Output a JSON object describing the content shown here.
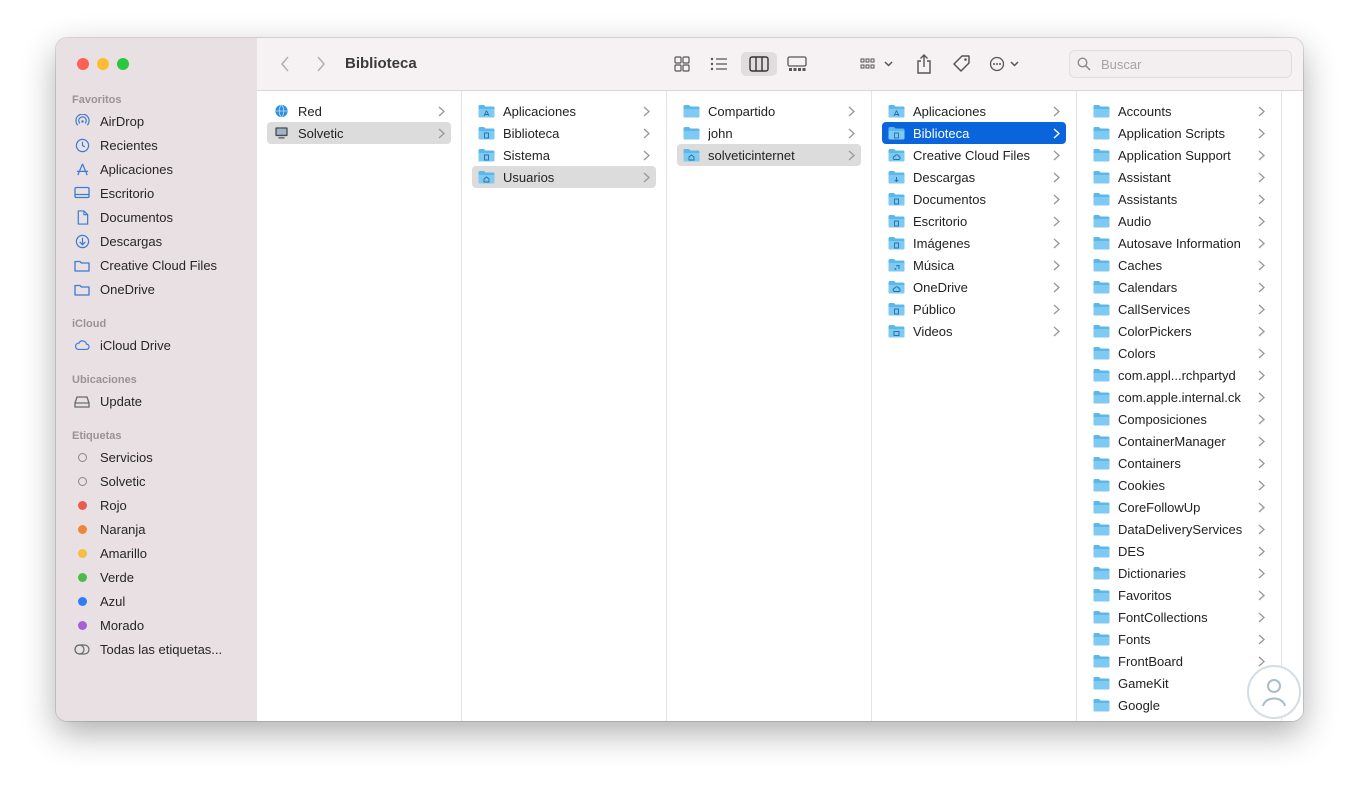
{
  "colors": {
    "accent": "#0a64dc",
    "close": "#fe5f57",
    "minimize": "#febc2e",
    "zoom": "#28c840",
    "folder": "#5bb8e8"
  },
  "toolbar": {
    "title": "Biblioteca",
    "search_placeholder": "Buscar"
  },
  "sidebar": {
    "favorites_title": "Favoritos",
    "favorites": [
      {
        "label": "AirDrop",
        "icon": "airdrop-icon"
      },
      {
        "label": "Recientes",
        "icon": "clock-icon"
      },
      {
        "label": "Aplicaciones",
        "icon": "apps-icon"
      },
      {
        "label": "Escritorio",
        "icon": "desktop-icon"
      },
      {
        "label": "Documentos",
        "icon": "document-icon"
      },
      {
        "label": "Descargas",
        "icon": "download-icon"
      },
      {
        "label": "Creative Cloud Files",
        "icon": "folder-icon"
      },
      {
        "label": "OneDrive",
        "icon": "folder-icon"
      }
    ],
    "icloud_title": "iCloud",
    "icloud": [
      {
        "label": "iCloud Drive",
        "icon": "cloud-icon"
      }
    ],
    "locations_title": "Ubicaciones",
    "locations": [
      {
        "label": "Update",
        "icon": "disk-icon"
      }
    ],
    "tags_title": "Etiquetas",
    "tags": [
      {
        "label": "Servicios",
        "color": ""
      },
      {
        "label": "Solvetic",
        "color": ""
      },
      {
        "label": "Rojo",
        "color": "#ec5a4d"
      },
      {
        "label": "Naranja",
        "color": "#f0863a"
      },
      {
        "label": "Amarillo",
        "color": "#f5be41"
      },
      {
        "label": "Verde",
        "color": "#4cbb4c"
      },
      {
        "label": "Azul",
        "color": "#2f7cf6"
      },
      {
        "label": "Morado",
        "color": "#a65fd6"
      },
      {
        "label": "Todas las etiquetas...",
        "color": "all"
      }
    ]
  },
  "columns": [
    {
      "items": [
        "Red",
        "Solvetic"
      ],
      "selected": 1,
      "selected_style": "grey"
    },
    {
      "items": [
        "Aplicaciones",
        "Biblioteca",
        "Sistema",
        "Usuarios"
      ],
      "selected": 3,
      "selected_style": "grey"
    },
    {
      "items": [
        "Compartido",
        "john",
        "solveticinternet"
      ],
      "selected": 2,
      "selected_style": "grey"
    },
    {
      "items": [
        "Aplicaciones",
        "Biblioteca",
        "Creative Cloud Files",
        "Descargas",
        "Documentos",
        "Escritorio",
        "Imágenes",
        "Música",
        "OneDrive",
        "Público",
        "Videos"
      ],
      "selected": 1,
      "selected_style": "blue"
    },
    {
      "items": [
        "Accounts",
        "Application Scripts",
        "Application Support",
        "Assistant",
        "Assistants",
        "Audio",
        "Autosave Information",
        "Caches",
        "Calendars",
        "CallServices",
        "ColorPickers",
        "Colors",
        "com.appl...rchpartyd",
        "com.apple.internal.ck",
        "Composiciones",
        "ContainerManager",
        "Containers",
        "Cookies",
        "CoreFollowUp",
        "DataDeliveryServices",
        "DES",
        "Dictionaries",
        "Favoritos",
        "FontCollections",
        "Fonts",
        "FrontBoard",
        "GameKit",
        "Google"
      ],
      "selected": -1,
      "selected_style": "none"
    }
  ]
}
